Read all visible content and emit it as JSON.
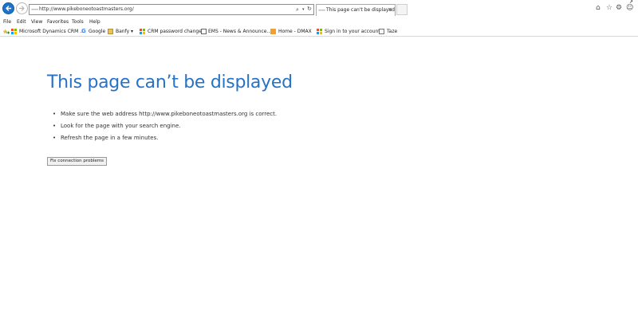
{
  "browser": {
    "url": "http://www.pikeboneotoastmasters.org/",
    "tab_title": "This page can't be displayed",
    "tab_close": "×",
    "page_glyph": "≡≡≡"
  },
  "menu": {
    "items": [
      "File",
      "Edit",
      "View",
      "Favorites",
      "Tools",
      "Help"
    ]
  },
  "favorites": {
    "items": [
      {
        "label": "Microsoft Dynamics CRM ..."
      },
      {
        "label": "Google"
      },
      {
        "label": "Banfy ▾"
      },
      {
        "label": "CRM password changes"
      },
      {
        "label": "EMS - News & Announce..."
      },
      {
        "label": "Home - DMAX"
      },
      {
        "label": "Sign in to your account"
      },
      {
        "label": "Taze"
      }
    ]
  },
  "error_page": {
    "title": "This page can’t be displayed",
    "suggestions": [
      "Make sure the web address http://www.pikeboneotoastmasters.org is correct.",
      "Look for the page with your search engine.",
      "Refresh the page in a few minutes."
    ],
    "fix_button_label": "Fix connection problems"
  },
  "icons": {
    "search": "⌕",
    "dropdown": "▾",
    "refresh": "↻",
    "home": "⌂",
    "star": "☆",
    "gear": "⚙",
    "smiley": "☺",
    "bullet": "•",
    "corner": "↗"
  },
  "colors": {
    "title_blue": "#2672c6",
    "back_button_blue": "#1e73c8"
  }
}
